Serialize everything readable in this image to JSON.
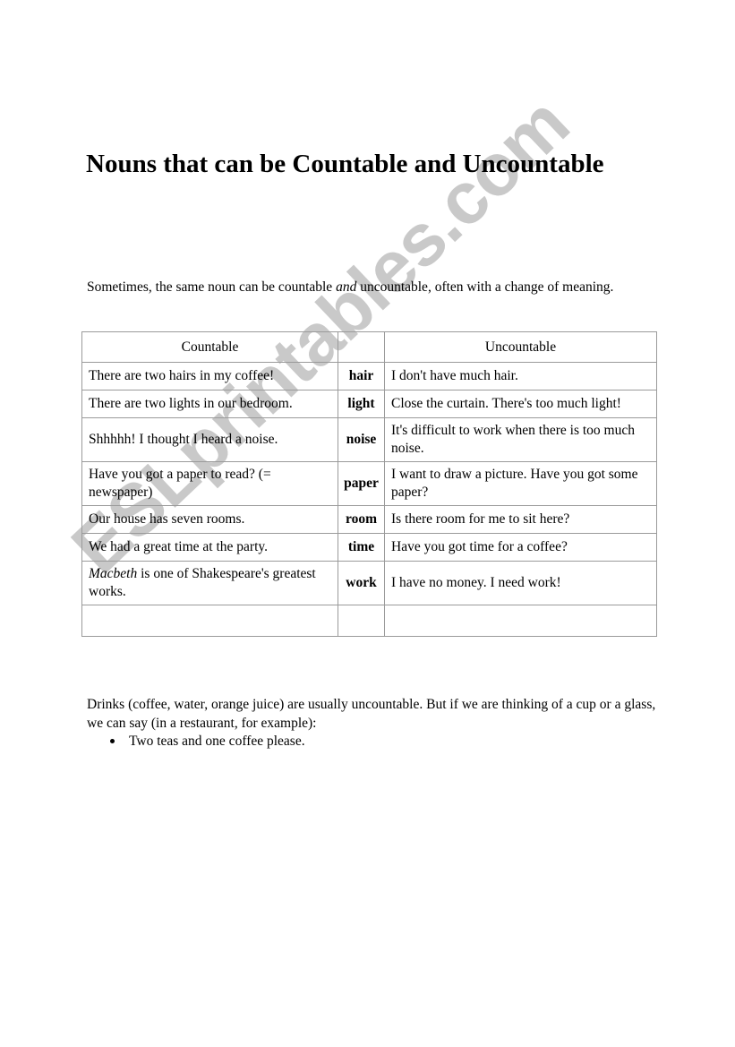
{
  "document": {
    "title": "Nouns that can be Countable and Uncountable",
    "intro_before_italic": "Sometimes, the same noun can be countable ",
    "intro_italic": "and",
    "intro_after_italic": " uncountable, often with a change of meaning."
  },
  "watermark": {
    "text": "ESLprintables.com",
    "color": "#c9c9c9"
  },
  "table": {
    "headers": {
      "countable": "Countable",
      "noun": "",
      "uncountable": "Uncountable"
    },
    "rows": [
      {
        "countable": "There are two hairs in my coffee!",
        "noun": "hair",
        "uncountable": "I don't have much hair."
      },
      {
        "countable": "There are two lights in our bedroom.",
        "noun": "light",
        "uncountable": "Close the curtain. There's too much light!"
      },
      {
        "countable": "Shhhhh! I thought I heard a noise.",
        "noun": "noise",
        "uncountable": "It's difficult to work when there is too much noise."
      },
      {
        "countable": "Have you got a paper to read? (= newspaper)",
        "noun": "paper",
        "uncountable": "I want to draw a picture. Have you got some paper?"
      },
      {
        "countable": "Our house has seven rooms.",
        "noun": "room",
        "uncountable": "Is there room for me to sit here?"
      },
      {
        "countable": "We had a great time at the party.",
        "noun": "time",
        "uncountable": "Have you got time for a coffee?"
      },
      {
        "countable_italic": "Macbeth",
        "countable_rest": " is one of Shakespeare's greatest works.",
        "noun": "work",
        "uncountable": "I have no money. I need work!"
      },
      {
        "countable": "",
        "noun": "",
        "uncountable": ""
      }
    ]
  },
  "drinks": {
    "paragraph": "Drinks (coffee, water, orange juice) are usually uncountable. But if we are thinking of a cup or a glass, we can say (in a restaurant, for example):",
    "examples": [
      "Two teas and one coffee please."
    ]
  }
}
